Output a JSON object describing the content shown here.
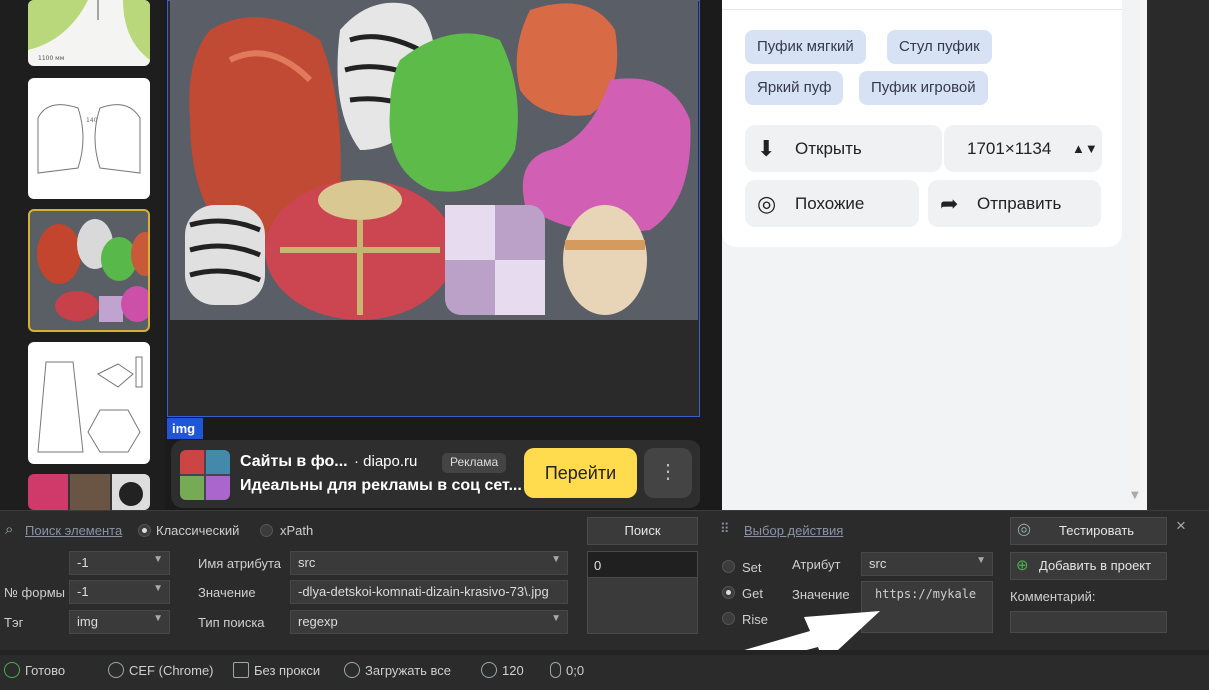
{
  "ad": {
    "title": "Сайты в фо...",
    "domain": "· diapo.ru",
    "badge": "Реклама",
    "description": "Идеальны для рекламы в соц сет...",
    "go_label": "Перейти",
    "more_label": "⋮"
  },
  "inspector": {
    "tag_label": "img"
  },
  "panel": {
    "chips": [
      "Пуфик мягкий",
      "Стул пуфик",
      "Яркий пуф",
      "Пуфик игровой"
    ],
    "open_label": "Открыть",
    "size_label": "1701×1134",
    "similar_label": "Похожие",
    "share_label": "Отправить"
  },
  "search": {
    "link_label": "Поиск элемента",
    "mode_classic": "Классический",
    "mode_xpath": "xPath",
    "button": "Поиск",
    "index_value": "-1",
    "form_label": "№ формы",
    "form_value": "-1",
    "tag_label": "Тэг",
    "tag_value": "img",
    "attr_name_label": "Имя атрибута",
    "attr_name_value": "src",
    "value_label": "Значение",
    "value_value": "-dlya-detskoi-komnati-dizain-krasivo-73\\.jpg",
    "search_type_label": "Тип поиска",
    "search_type_value": "regexp",
    "result_value": "0"
  },
  "action": {
    "link_label": "Выбор действия",
    "set": "Set",
    "get": "Get",
    "rise": "Rise",
    "attr_label": "Атрибут",
    "attr_value": "src",
    "value_label": "Значение",
    "value_value": "https://mykale"
  },
  "actions_right": {
    "test_label": "Тестировать",
    "add_label": "Добавить в проект",
    "comment_label": "Комментарий:",
    "close": "×"
  },
  "status": {
    "ready": "Готово",
    "engine": "CEF (Chrome)",
    "proxy": "Без прокси",
    "load": "Загружать все",
    "timer": "120",
    "mouse": "0;0"
  }
}
